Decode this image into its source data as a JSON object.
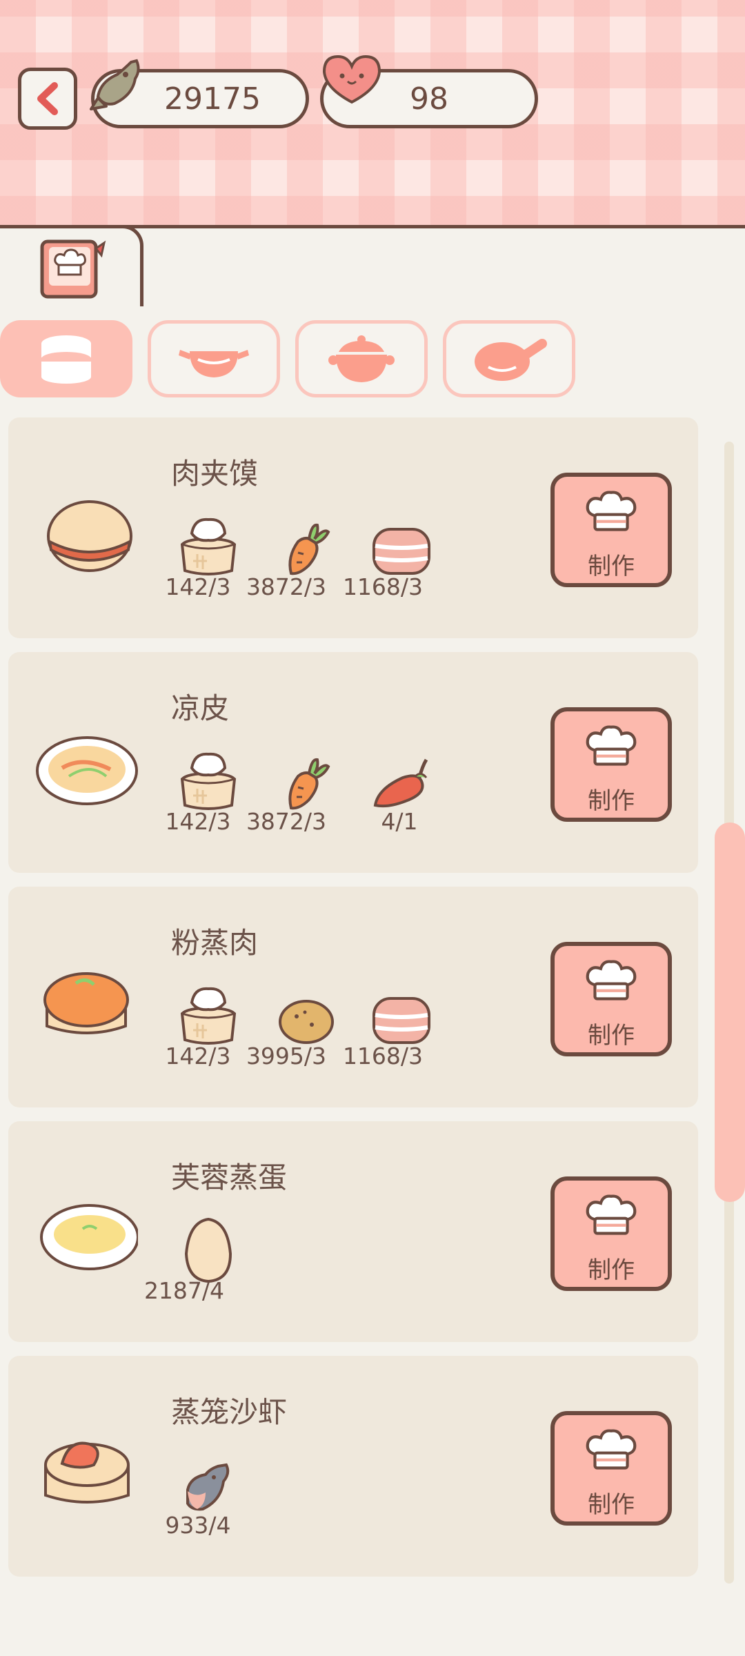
{
  "header": {
    "fish_count": "29175",
    "heart_count": "98"
  },
  "tabs": [
    {
      "name": "steamer",
      "active": true
    },
    {
      "name": "wok",
      "active": false
    },
    {
      "name": "pot",
      "active": false
    },
    {
      "name": "pan",
      "active": false
    }
  ],
  "recipes": [
    {
      "title": "肉夹馍",
      "dish_icon": "roujiamo-icon",
      "ingredients": [
        {
          "icon": "flour-icon",
          "qty": "142/3"
        },
        {
          "icon": "carrot-icon",
          "qty": "3872/3"
        },
        {
          "icon": "meat-icon",
          "qty": "1168/3"
        }
      ],
      "button_label": "制作"
    },
    {
      "title": "凉皮",
      "dish_icon": "liangpi-icon",
      "ingredients": [
        {
          "icon": "flour-icon",
          "qty": "142/3"
        },
        {
          "icon": "carrot-icon",
          "qty": "3872/3"
        },
        {
          "icon": "chili-icon",
          "qty": "4/1"
        }
      ],
      "button_label": "制作"
    },
    {
      "title": "粉蒸肉",
      "dish_icon": "fenzhengrou-icon",
      "ingredients": [
        {
          "icon": "flour-icon",
          "qty": "142/3"
        },
        {
          "icon": "potato-icon",
          "qty": "3995/3"
        },
        {
          "icon": "meat-icon",
          "qty": "1168/3"
        }
      ],
      "button_label": "制作"
    },
    {
      "title": "芙蓉蒸蛋",
      "dish_icon": "steamed-egg-icon",
      "ingredients": [
        {
          "icon": "egg-icon",
          "qty": "2187/4"
        }
      ],
      "button_label": "制作"
    },
    {
      "title": "蒸笼沙虾",
      "dish_icon": "steamed-shrimp-icon",
      "ingredients": [
        {
          "icon": "fish-icon",
          "qty": "933/4"
        }
      ],
      "button_label": "制作"
    }
  ],
  "colors": {
    "accent": "#fcb9ad",
    "outline": "#6b4a3f",
    "card": "#efe8dc"
  }
}
